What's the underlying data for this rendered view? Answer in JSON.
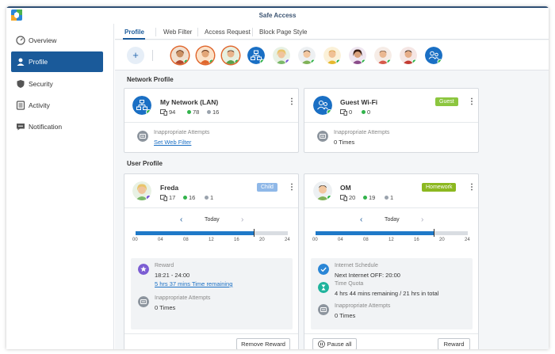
{
  "window": {
    "title": "Safe Access"
  },
  "sidebar": {
    "items": [
      {
        "label": "Overview",
        "icon": "overview-gauge-icon"
      },
      {
        "label": "Profile",
        "icon": "profile-icon",
        "active": true
      },
      {
        "label": "Security",
        "icon": "shield-icon"
      },
      {
        "label": "Activity",
        "icon": "activity-list-icon"
      },
      {
        "label": "Notification",
        "icon": "speech-bubble-icon"
      }
    ]
  },
  "tabs": [
    {
      "label": "Profile",
      "active": true
    },
    {
      "label": "Web Filter"
    },
    {
      "label": "Access Request"
    },
    {
      "label": "Block Page Style"
    }
  ],
  "sections": {
    "network": "Network Profile",
    "user": "User Profile"
  },
  "network_profiles": [
    {
      "name": "My Network (LAN)",
      "devices": "94",
      "online": "78",
      "offline": "16",
      "attempts_label": "Inappropriate Attempts",
      "attempts_link": "Set Web Filter"
    },
    {
      "name": "Guest Wi-Fi",
      "badge": "Guest",
      "devices": "0",
      "online": "0",
      "attempts_label": "Inappropriate Attempts",
      "attempts_value": "0 Times"
    }
  ],
  "user_profiles": [
    {
      "name": "Freda",
      "badge": "Child",
      "devices": "17",
      "online": "16",
      "offline": "1",
      "day": "Today",
      "ticks": [
        "00",
        "04",
        "08",
        "12",
        "16",
        "20",
        "24"
      ],
      "current_hour": 18.6,
      "reward_label": "Reward",
      "reward_time": "18:21 - 24:00",
      "reward_remaining": "5 hrs 37 mins Time remaining",
      "attempts_label": "Inappropriate Attempts",
      "attempts_value": "0 Times",
      "button": "Remove Reward"
    },
    {
      "name": "OM",
      "badge": "Homework",
      "devices": "20",
      "online": "19",
      "offline": "1",
      "day": "Today",
      "ticks": [
        "00",
        "04",
        "08",
        "12",
        "16",
        "20",
        "24"
      ],
      "current_hour": 18.6,
      "schedule_label": "Internet Schedule",
      "schedule_value": "Next Internet OFF: 20:00",
      "quota_label": "Time Quota",
      "quota_value": "4 hrs 44 mins remaining / 21 hrs in total",
      "attempts_label": "Inappropriate Attempts",
      "attempts_value": "0 Times",
      "pause_button": "Pause all",
      "button": "Reward"
    }
  ],
  "colors": {
    "accent": "#1a5a9a",
    "online": "#32b34b",
    "guest": "#8cc63f",
    "child": "#8fb8e8",
    "homework": "#8cb820"
  }
}
